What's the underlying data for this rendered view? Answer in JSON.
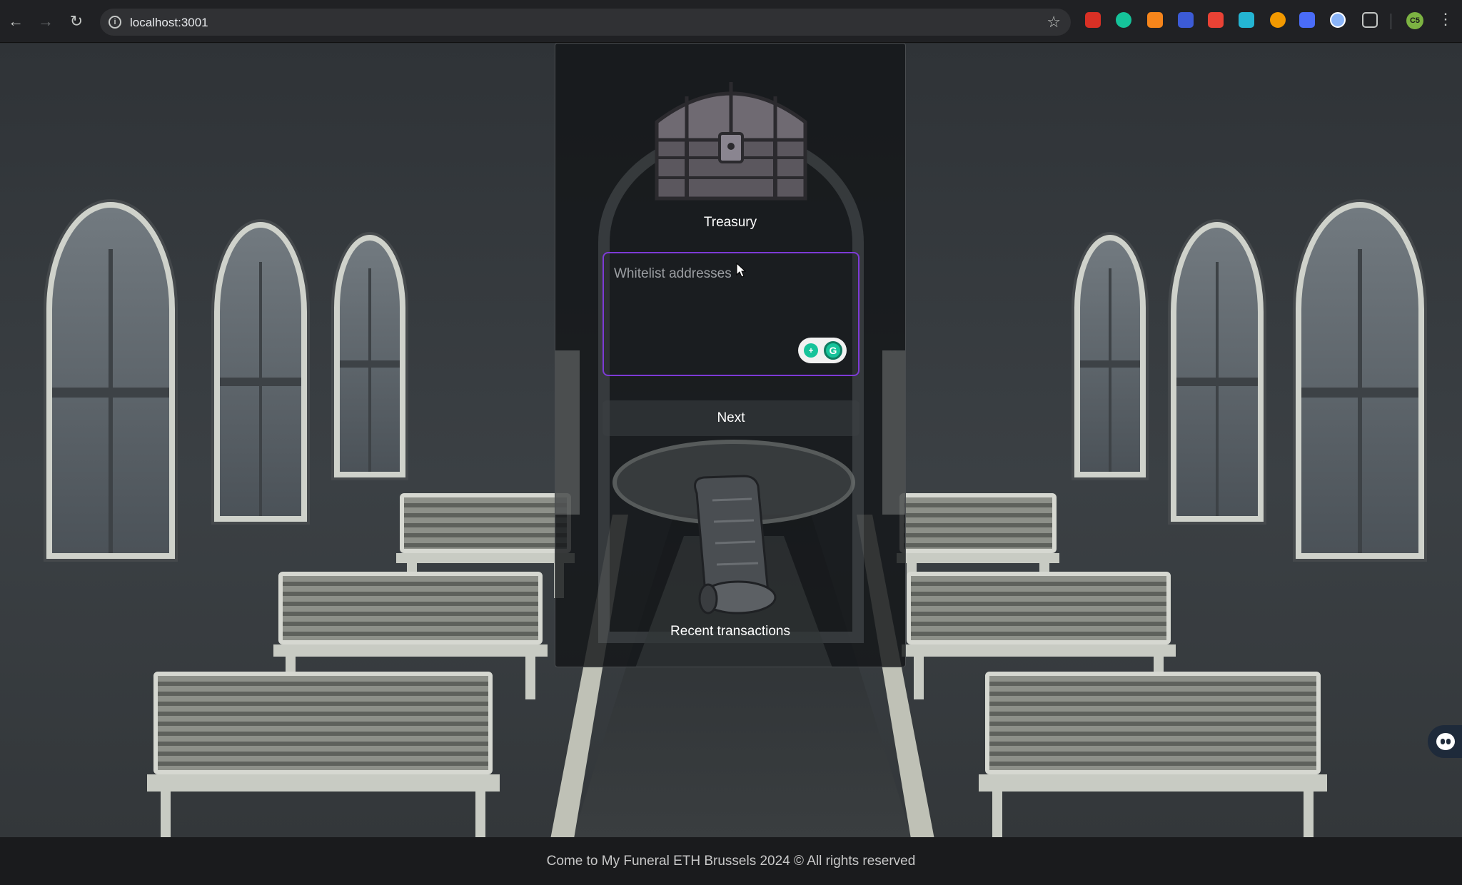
{
  "browser": {
    "url": "localhost:3001",
    "profile_initials": "C5",
    "extensions": [
      {
        "name": "gift-extension-icon",
        "color": "#d93025"
      },
      {
        "name": "grammarly-extension-icon",
        "color": "#15c39a"
      },
      {
        "name": "metamask-extension-icon",
        "color": "#f6851b"
      },
      {
        "name": "shield-extension-icon",
        "color": "#3c5bd6"
      },
      {
        "name": "colorzilla-extension-icon",
        "color": "#e94235"
      },
      {
        "name": "target-extension-icon",
        "color": "#24b5d3"
      },
      {
        "name": "flame-extension-icon",
        "color": "#f29900"
      },
      {
        "name": "rainbow-extension-icon",
        "color": "#4a6cf7"
      },
      {
        "name": "wallet-extension-icon",
        "color": "#8ab4f8"
      },
      {
        "name": "puzzle-extension-icon",
        "color": "#c4c7c5"
      }
    ]
  },
  "panel": {
    "treasury_label": "Treasury",
    "whitelist_placeholder": "Whitelist addresses",
    "whitelist_value": "",
    "next_label": "Next",
    "recent_label": "Recent transactions"
  },
  "footer": {
    "text": "Come to My Funeral ETH Brussels 2024 © All rights reserved"
  },
  "colors": {
    "input_border": "#7d3ad6",
    "footer_bg": "#1a1b1d",
    "grammarly": "#15c39a"
  }
}
